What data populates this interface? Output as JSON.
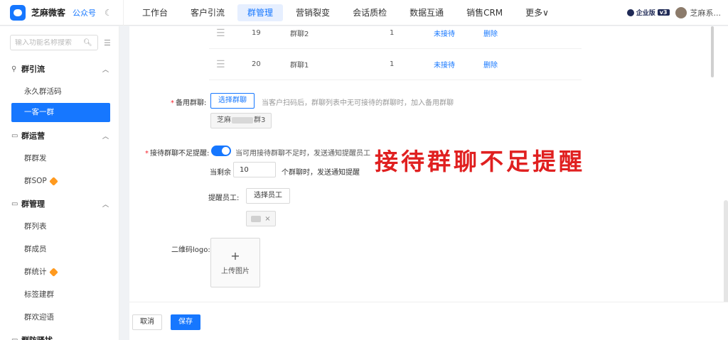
{
  "brand": {
    "name": "芝麻微客",
    "sub": "公众号"
  },
  "nav": {
    "items": [
      "工作台",
      "客户引流",
      "群管理",
      "营销裂变",
      "会话质检",
      "数据互通",
      "销售CRM",
      "更多∨"
    ],
    "active": "群管理"
  },
  "account": {
    "edition": "企业版",
    "version": "v3",
    "username": "芝麻系..."
  },
  "sidebar": {
    "search_placeholder": "输入功能名称搜索",
    "groups": [
      {
        "label": "群引流",
        "items": [
          "永久群活码",
          "一客一群"
        ]
      },
      {
        "label": "群运营",
        "items": [
          "群群发",
          "群SOP"
        ]
      },
      {
        "label": "群管理",
        "items": [
          "群列表",
          "群成员",
          "群统计",
          "标签建群",
          "群欢迎语"
        ]
      },
      {
        "label": "群防骚扰",
        "items": []
      }
    ],
    "active_item": "一客一群"
  },
  "table": {
    "rows": [
      {
        "idx": "19",
        "name": "群聊2",
        "count": "1",
        "status": "未接待",
        "action": "删除"
      },
      {
        "idx": "20",
        "name": "群聊1",
        "count": "1",
        "status": "未接待",
        "action": "删除"
      }
    ]
  },
  "form": {
    "backup_label": "备用群聊:",
    "backup_button": "选择群聊",
    "backup_hint": "当客户扫码后，群聊列表中无可接待的群聊时，加入备用群聊",
    "backup_tag_prefix": "芝麻",
    "backup_tag_suffix": "群3",
    "remind_label": "接待群聊不足提醒:",
    "remind_enabled": true,
    "remind_hint": "当可用接待群聊不足时，发送通知提醒员工",
    "remain_prefix": "当剩余",
    "remain_value": "10",
    "remain_suffix": "个群聊时，发送通知提醒",
    "staff_label": "提醒员工:",
    "staff_button": "选择员工",
    "logo_label": "二维码logo:",
    "upload_text": "上传图片"
  },
  "annotation": "接待群聊不足提醒",
  "footer": {
    "cancel": "取消",
    "save": "保存"
  },
  "colors": {
    "primary": "#1677ff",
    "annotation": "#e02020",
    "required": "#f5222d"
  }
}
